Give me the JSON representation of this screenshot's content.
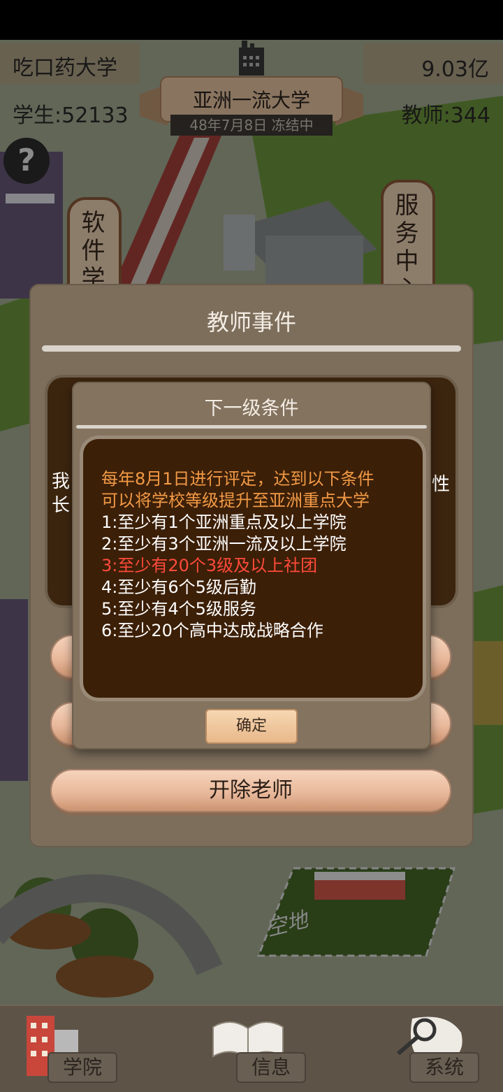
{
  "hud": {
    "school_name": "吃口药大学",
    "money": "9.03亿",
    "students": "学生:52133",
    "teachers": "教师:344",
    "rank_title": "亚洲一流大学",
    "date_status": "48年7月8日 冻结中",
    "help_label": "?"
  },
  "map_signs": {
    "software_college": "软件学院",
    "service_center": "服务中心",
    "empty_lot": "空地"
  },
  "teacher_event": {
    "title": "教师事件",
    "side_text_left": "我长",
    "side_text_right": "性",
    "fire_button": "开除老师"
  },
  "next_level_dialog": {
    "title": "下一级条件",
    "intro_line1": "每年8月1日进行评定，达到以下条件",
    "intro_line2": "可以将学校等级提升至亚洲重点大学",
    "conditions": [
      {
        "text": "1:至少有1个亚洲重点及以上学院",
        "met": true
      },
      {
        "text": "2:至少有3个亚洲一流及以上学院",
        "met": true
      },
      {
        "text": "3:至少有20个3级及以上社团",
        "met": false
      },
      {
        "text": "4:至少有6个5级后勤",
        "met": true
      },
      {
        "text": "5:至少有4个5级服务",
        "met": true
      },
      {
        "text": "6:至少20个高中达成战略合作",
        "met": true
      }
    ],
    "confirm_label": "确定"
  },
  "bottom_nav": {
    "items": [
      {
        "label": "学院",
        "icon": "building-icon"
      },
      {
        "label": "信息",
        "icon": "book-icon"
      },
      {
        "label": "系统",
        "icon": "magnifier-icon"
      }
    ]
  },
  "colors": {
    "panel": "#7d6e5c",
    "content_bg": "#3c1f07",
    "intro_text": "#f29a46",
    "unmet_condition": "#ff4a3a",
    "button_peach": "#e9b99c"
  }
}
